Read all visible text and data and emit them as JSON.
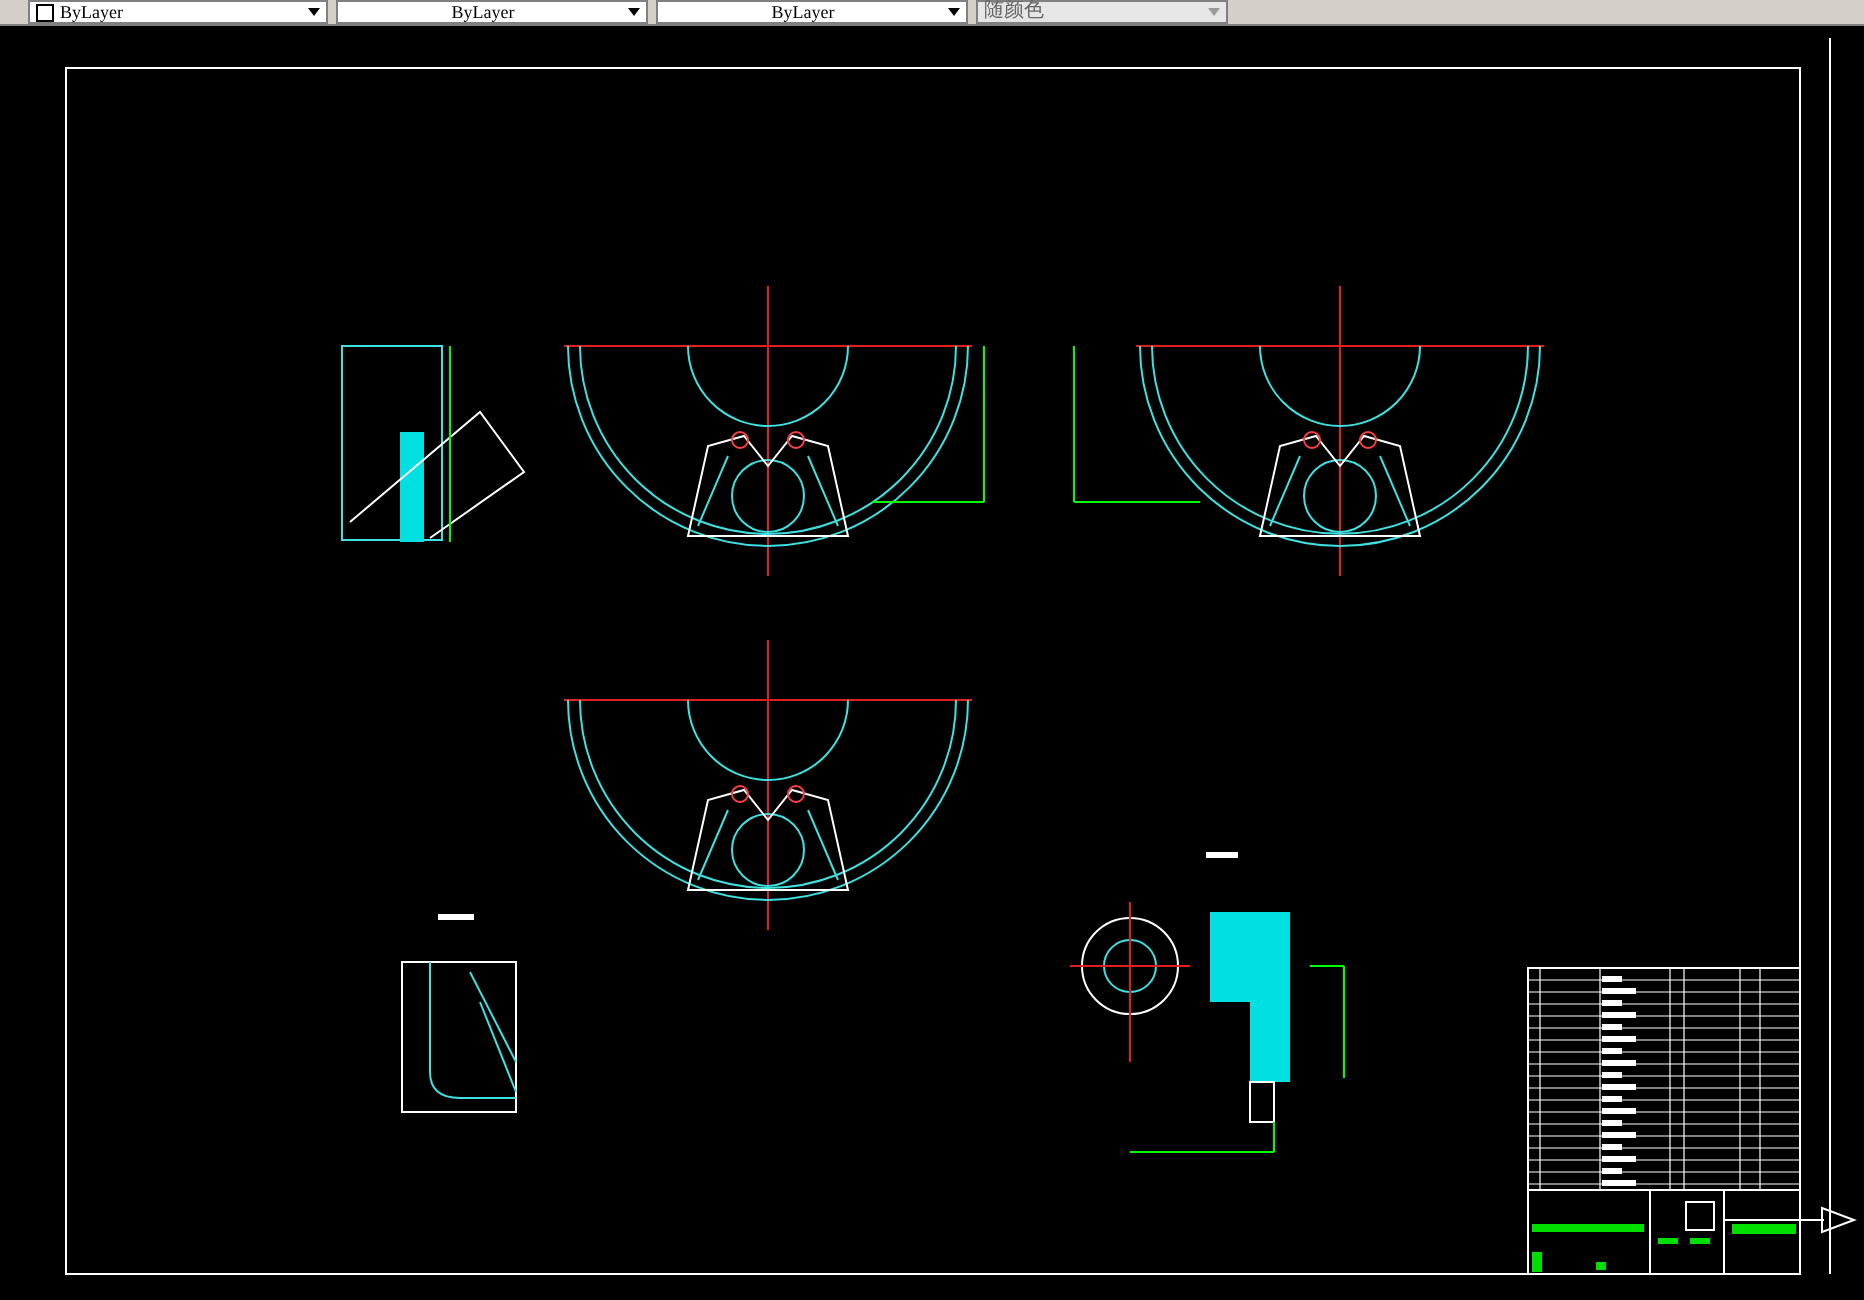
{
  "toolbar": {
    "dropdowns": [
      {
        "value": "ByLayer",
        "swatch": true,
        "disabled": false
      },
      {
        "value": "ByLayer",
        "swatch": false,
        "disabled": false
      },
      {
        "value": "ByLayer",
        "swatch": false,
        "disabled": false
      },
      {
        "value": "随颜色",
        "swatch": false,
        "disabled": true
      }
    ]
  }
}
